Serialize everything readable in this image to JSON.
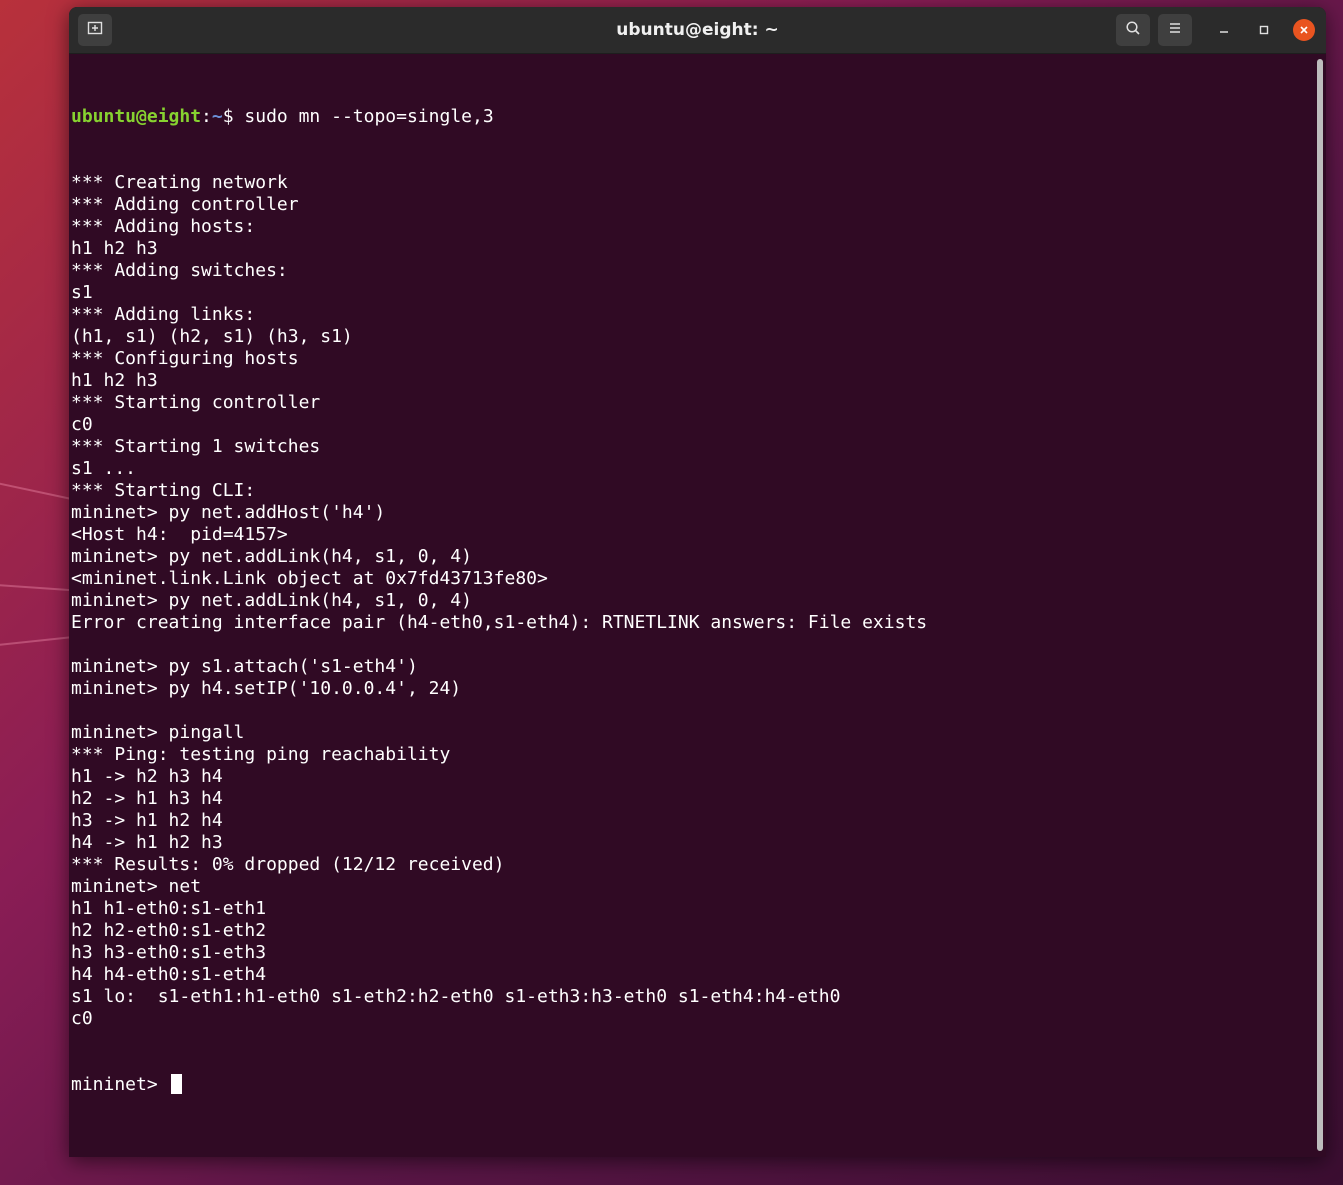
{
  "window": {
    "title": "ubuntu@eight: ~"
  },
  "icons": {
    "new_tab": "new-tab-icon",
    "search": "search-icon",
    "menu": "hamburger-menu-icon",
    "minimize": "minimize-icon",
    "maximize": "maximize-icon",
    "close": "close-icon"
  },
  "colors": {
    "terminal_bg": "#300a24",
    "prompt_user": "#87d230",
    "prompt_path": "#6b8fd8",
    "close_button": "#e95420"
  },
  "terminal": {
    "first_prompt": {
      "user_host": "ubuntu@eight",
      "separator": ":",
      "path": "~",
      "symbol": "$",
      "command": " sudo mn --topo=single,3"
    },
    "lines": [
      "*** Creating network",
      "*** Adding controller",
      "*** Adding hosts:",
      "h1 h2 h3",
      "*** Adding switches:",
      "s1",
      "*** Adding links:",
      "(h1, s1) (h2, s1) (h3, s1)",
      "*** Configuring hosts",
      "h1 h2 h3",
      "*** Starting controller",
      "c0",
      "*** Starting 1 switches",
      "s1 ...",
      "*** Starting CLI:",
      "mininet> py net.addHost('h4')",
      "<Host h4:  pid=4157>",
      "mininet> py net.addLink(h4, s1, 0, 4)",
      "<mininet.link.Link object at 0x7fd43713fe80>",
      "mininet> py net.addLink(h4, s1, 0, 4)",
      "Error creating interface pair (h4-eth0,s1-eth4): RTNETLINK answers: File exists",
      "",
      "mininet> py s1.attach('s1-eth4')",
      "mininet> py h4.setIP('10.0.0.4', 24)",
      "",
      "mininet> pingall",
      "*** Ping: testing ping reachability",
      "h1 -> h2 h3 h4",
      "h2 -> h1 h3 h4",
      "h3 -> h1 h2 h4",
      "h4 -> h1 h2 h3",
      "*** Results: 0% dropped (12/12 received)",
      "mininet> net",
      "h1 h1-eth0:s1-eth1",
      "h2 h2-eth0:s1-eth2",
      "h3 h3-eth0:s1-eth3",
      "h4 h4-eth0:s1-eth4",
      "s1 lo:  s1-eth1:h1-eth0 s1-eth2:h2-eth0 s1-eth3:h3-eth0 s1-eth4:h4-eth0",
      "c0"
    ],
    "current_prompt": "mininet> "
  }
}
